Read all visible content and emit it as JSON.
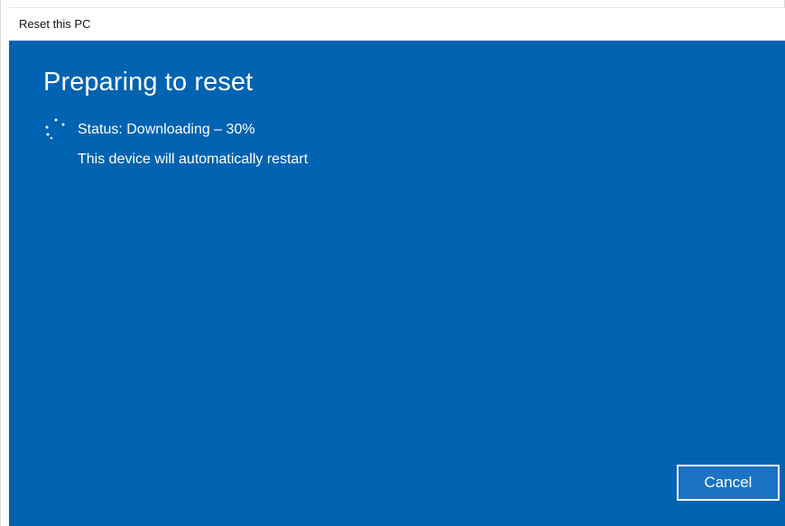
{
  "window": {
    "title": "Reset this PC"
  },
  "main": {
    "heading": "Preparing to reset",
    "status": "Status: Downloading – 30%",
    "restart_notice": "This device will automatically restart"
  },
  "progress": {
    "percent": 30
  },
  "footer": {
    "cancel_label": "Cancel"
  },
  "colors": {
    "background": "#0063b1",
    "titlebar": "#ffffff",
    "text": "#ffffff"
  },
  "icons": {
    "spinner": "loading-spinner-icon"
  }
}
